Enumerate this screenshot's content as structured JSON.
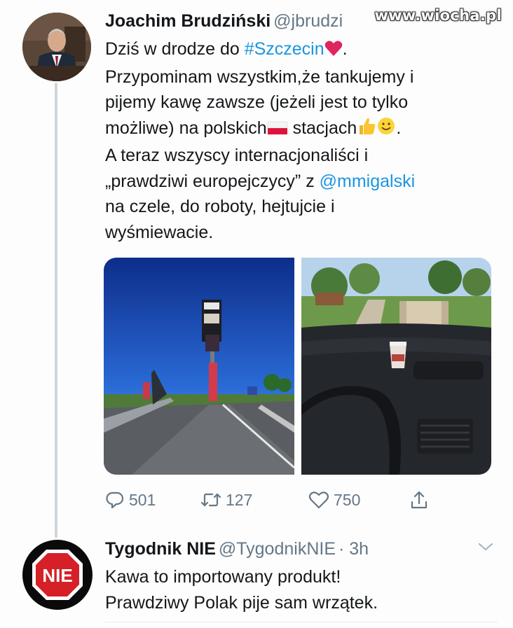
{
  "watermark": "www.wiocha.pl",
  "tweet": {
    "author_name": "Joachim Brudziński",
    "author_handle": "@jbrudzi",
    "text_lines": [
      "Dziś w drodze do ",
      "Przypominam wszystkim,że tankujemy i",
      "pijemy kawę zawsze (jeżeli jest to tylko",
      "możliwe) na polskich",
      " stacjach",
      "A teraz wszyscy internacjonaliści i",
      "„prawdziwi europejczycy”  z ",
      "na czele, do roboty, hejtujcie i",
      "wyśmiewacie."
    ],
    "hashtag": "#Szczecin",
    "mention": "@mmigalski",
    "trailing_dot": ".",
    "reply_count": "501",
    "retweet_count": "127",
    "like_count": "750"
  },
  "reply": {
    "author_name": "Tygodnik NIE",
    "author_handle": "@TygodnikNIE",
    "time": "· 3h",
    "avatar_text": "NIE",
    "text_lines": [
      "Kawa to importowany produkt!",
      "Prawdziwy Polak pije sam wrzątek."
    ]
  },
  "colors": {
    "link": "#1b95e0",
    "secondary": "#657786",
    "text": "#14171a",
    "stop_red": "#d62027"
  },
  "icons": [
    "reply-icon",
    "retweet-icon",
    "like-icon",
    "share-icon",
    "chevron-down-icon",
    "heart-emoji",
    "flag-emoji",
    "thumbs-up-emoji",
    "smile-emoji"
  ]
}
